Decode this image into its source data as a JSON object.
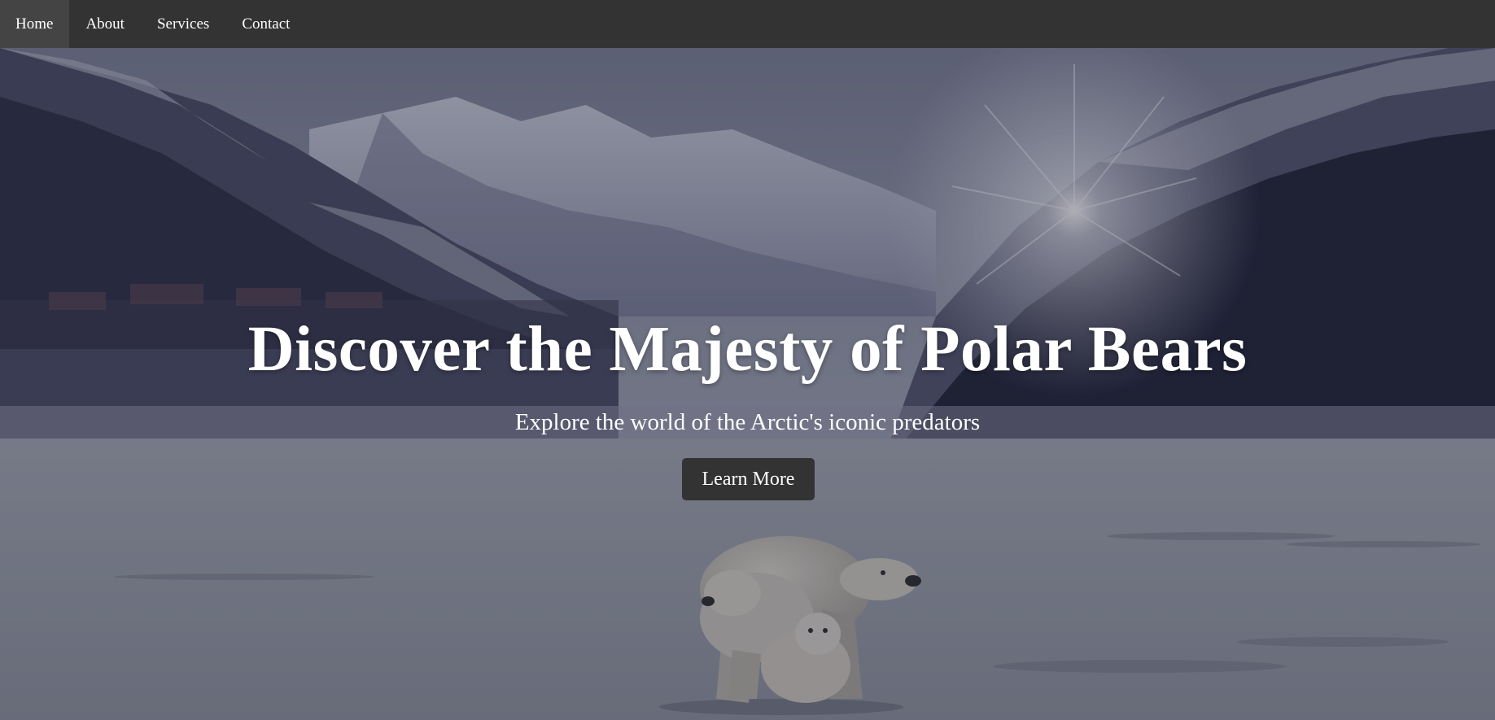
{
  "nav": {
    "items": [
      {
        "label": "Home"
      },
      {
        "label": "About"
      },
      {
        "label": "Services"
      },
      {
        "label": "Contact"
      }
    ]
  },
  "hero": {
    "title": "Discover the Majesty of Polar Bears",
    "subtitle": "Explore the world of the Arctic's iconic predators",
    "cta_label": "Learn More",
    "background_image": "arctic-mountain-lake-polar-bears-photo"
  },
  "colors": {
    "navbar_bg": "#333333",
    "nav_text": "#ffffff",
    "button_bg": "#333333",
    "button_text": "#ffffff",
    "hero_text": "#ffffff"
  }
}
